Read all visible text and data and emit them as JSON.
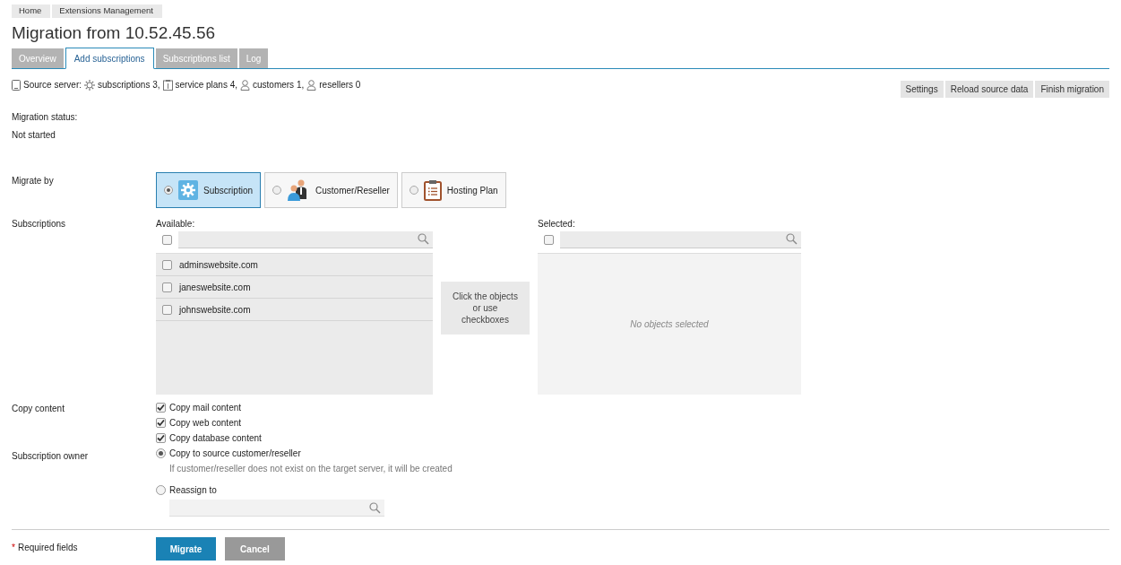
{
  "breadcrumbs": [
    "Home",
    "Extensions Management"
  ],
  "title": "Migration from 10.52.45.56",
  "tabs": [
    {
      "label": "Overview",
      "selected": false
    },
    {
      "label": "Add subscriptions",
      "selected": true
    },
    {
      "label": "Subscriptions list",
      "selected": false
    },
    {
      "label": "Log",
      "selected": false
    }
  ],
  "source_server": {
    "label": "Source server:",
    "stats": [
      {
        "kind": "gear",
        "text": "subscriptions 3,"
      },
      {
        "kind": "plan",
        "text": "service plans 4,"
      },
      {
        "kind": "user",
        "text": "customers 1,"
      },
      {
        "kind": "user",
        "text": "resellers 0"
      }
    ]
  },
  "toolbar_buttons": [
    "Settings",
    "Reload source data",
    "Finish migration"
  ],
  "migration_status": {
    "label": "Migration status:",
    "value": "Not started"
  },
  "migrate_by": {
    "label": "Migrate by",
    "options": [
      {
        "kind": "gear",
        "label": "Subscription",
        "selected": true
      },
      {
        "kind": "people",
        "label": "Customer/Reseller",
        "selected": false
      },
      {
        "kind": "clipboard",
        "label": "Hosting Plan",
        "selected": false
      }
    ]
  },
  "subscriptions": {
    "label": "Subscriptions",
    "available": {
      "label": "Available:",
      "select_all": false,
      "items": [
        {
          "name": "adminswebsite.com",
          "checked": false
        },
        {
          "name": "janeswebsite.com",
          "checked": false
        },
        {
          "name": "johnswebsite.com",
          "checked": false
        }
      ]
    },
    "hint": "Click the objects or use checkboxes",
    "selected": {
      "label": "Selected:",
      "select_all": false,
      "empty_text": "No objects selected"
    }
  },
  "copy_content": {
    "label": "Copy content",
    "options": [
      {
        "label": "Copy mail content",
        "checked": true
      },
      {
        "label": "Copy web content",
        "checked": true
      },
      {
        "label": "Copy database content",
        "checked": true
      }
    ]
  },
  "subscription_owner": {
    "label": "Subscription owner",
    "options": [
      {
        "label": "Copy to source customer/reseller",
        "selected": true,
        "note": "If customer/reseller does not exist on the target server, it will be created"
      },
      {
        "label": "Reassign to",
        "selected": false,
        "field": true
      }
    ]
  },
  "footer": {
    "required_mark": "*",
    "required_text": "Required fields",
    "buttons": [
      {
        "kind": "primary",
        "label": "Migrate"
      },
      {
        "kind": "secondary",
        "label": "Cancel"
      }
    ]
  }
}
